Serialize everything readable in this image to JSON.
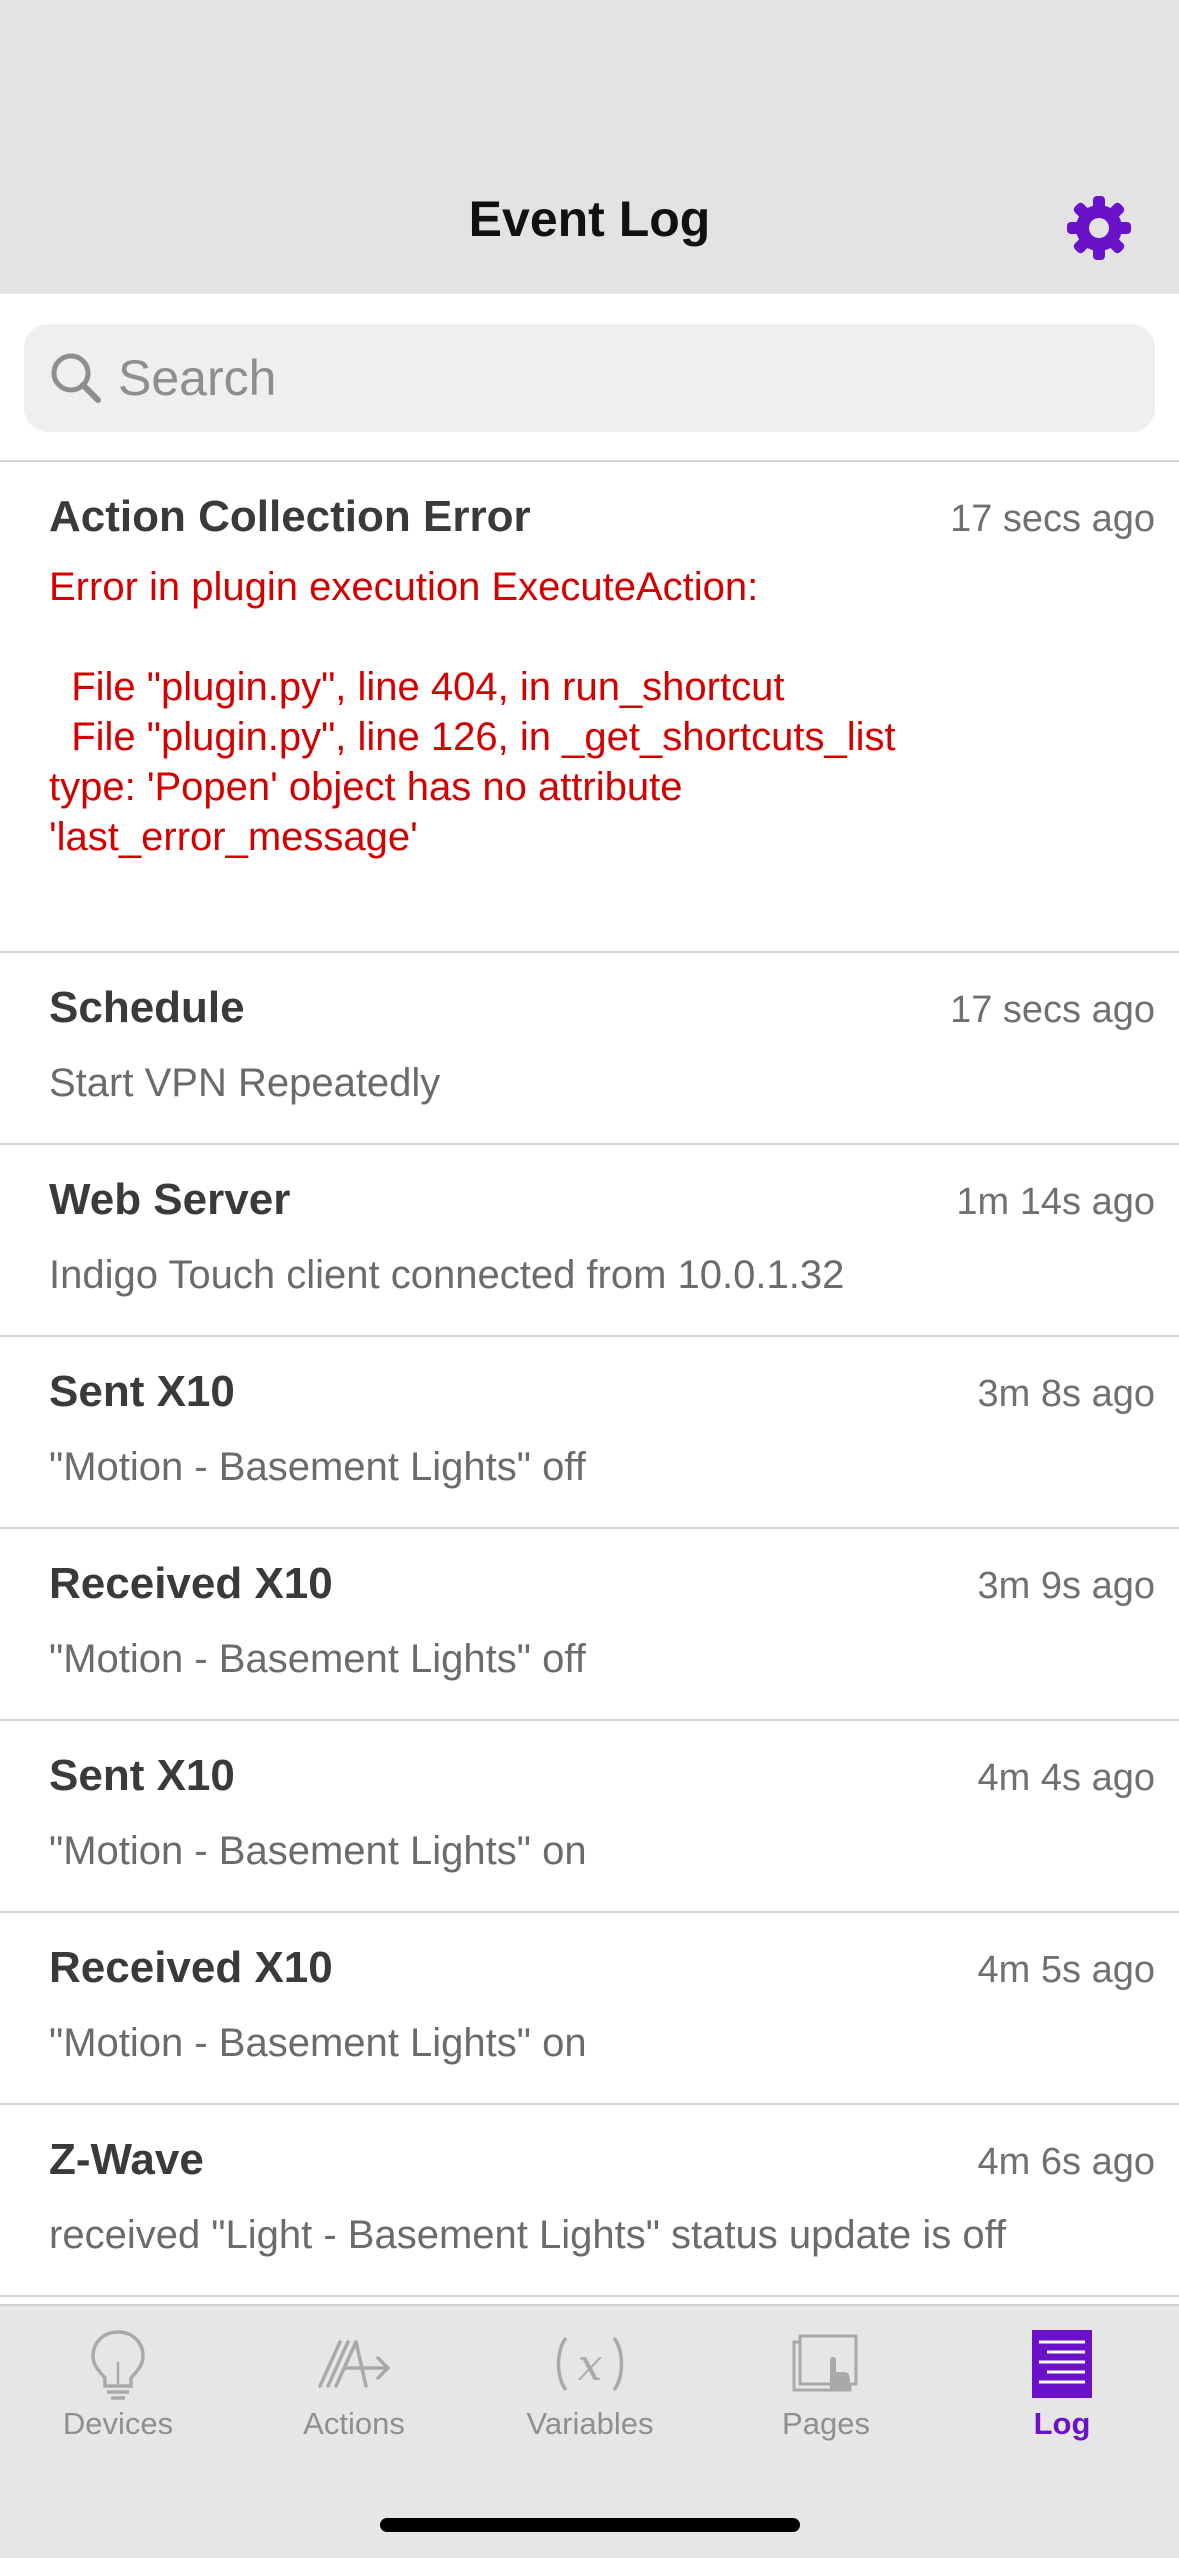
{
  "nav": {
    "title": "Event Log",
    "settings_icon": "gear-icon",
    "accent_color": "#6a11c9"
  },
  "search": {
    "placeholder": "Search",
    "value": ""
  },
  "log": {
    "entries": [
      {
        "title": "Action Collection Error",
        "time": "17 secs ago",
        "is_error": true,
        "message": "Error in plugin execution ExecuteAction:\n\n  File \"plugin.py\", line 404, in run_shortcut\n  File \"plugin.py\", line 126, in _get_shortcuts_list\ntype: 'Popen' object has no attribute\n'last_error_message'"
      },
      {
        "title": "Schedule",
        "time": "17 secs ago",
        "message": "Start VPN Repeatedly"
      },
      {
        "title": "Web Server",
        "time": "1m 14s ago",
        "message": "Indigo Touch client connected from 10.0.1.32"
      },
      {
        "title": "Sent X10",
        "time": "3m 8s ago",
        "message": "\"Motion - Basement Lights\" off"
      },
      {
        "title": "Received X10",
        "time": "3m 9s ago",
        "message": "\"Motion - Basement Lights\" off"
      },
      {
        "title": "Sent X10",
        "time": "4m 4s ago",
        "message": "\"Motion - Basement Lights\" on"
      },
      {
        "title": "Received X10",
        "time": "4m 5s ago",
        "message": "\"Motion - Basement Lights\" on"
      },
      {
        "title": "Z-Wave",
        "time": "4m 6s ago",
        "message": "received \"Light - Basement Lights\" status update is off"
      }
    ],
    "error_color": "#d40000"
  },
  "tabs": [
    {
      "label": "Devices",
      "icon": "lightbulb-icon",
      "active": false
    },
    {
      "label": "Actions",
      "icon": "actions-icon",
      "active": false
    },
    {
      "label": "Variables",
      "icon": "variable-x-icon",
      "active": false
    },
    {
      "label": "Pages",
      "icon": "pages-icon",
      "active": false
    },
    {
      "label": "Log",
      "icon": "log-icon",
      "active": true
    }
  ]
}
